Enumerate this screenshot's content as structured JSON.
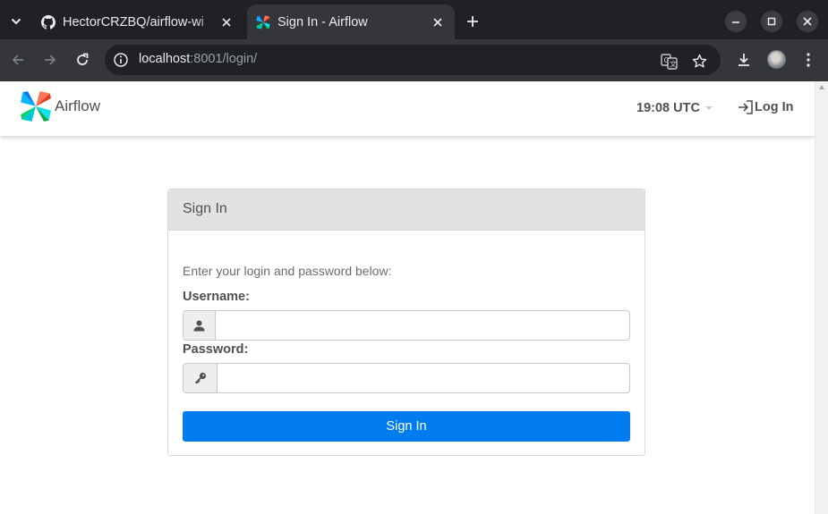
{
  "browser": {
    "tabs": [
      {
        "title": "HectorCRZBQ/airflow-wi",
        "icon": "github-icon",
        "active": false
      },
      {
        "title": "Sign In - Airflow",
        "icon": "airflow-pinwheel-icon",
        "active": true
      }
    ],
    "url_host": "localhost",
    "url_rest": ":8001/login/"
  },
  "navbar": {
    "brand": "Airflow",
    "clock": "19:08 UTC",
    "login_label": "Log In"
  },
  "login": {
    "panel_title": "Sign In",
    "intro": "Enter your login and password below:",
    "username_label": "Username:",
    "username_value": "",
    "password_label": "Password:",
    "password_value": "",
    "submit_label": "Sign In"
  },
  "colors": {
    "primary": "#017cee",
    "text": "#51504f",
    "panel_header": "#e2e2e2",
    "chrome_dark": "#202124",
    "chrome_toolbar": "#35363a"
  }
}
